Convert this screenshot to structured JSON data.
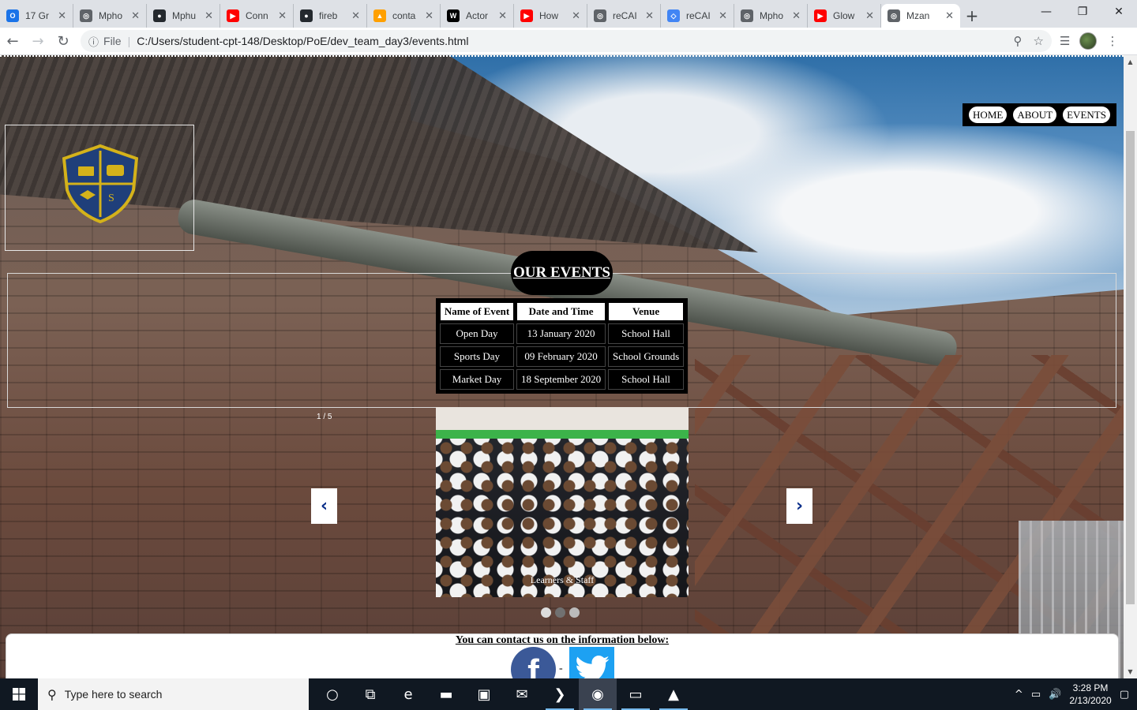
{
  "browser": {
    "tabs": [
      {
        "title": "17 Gr",
        "fav_color": "#1a73e8",
        "fav_glyph": "O"
      },
      {
        "title": "Mpho",
        "fav_color": "#5f6368",
        "fav_glyph": "◎"
      },
      {
        "title": "Mphu",
        "fav_color": "#24292e",
        "fav_glyph": "●"
      },
      {
        "title": "Conn",
        "fav_color": "#ff0000",
        "fav_glyph": "▶"
      },
      {
        "title": "fireb",
        "fav_color": "#24292e",
        "fav_glyph": "●"
      },
      {
        "title": "conta",
        "fav_color": "#ffa000",
        "fav_glyph": "▲"
      },
      {
        "title": "Actor",
        "fav_color": "#000000",
        "fav_glyph": "W"
      },
      {
        "title": "How",
        "fav_color": "#ff0000",
        "fav_glyph": "▶"
      },
      {
        "title": "reCAI",
        "fav_color": "#5f6368",
        "fav_glyph": "◎"
      },
      {
        "title": "reCAI",
        "fav_color": "#4285f4",
        "fav_glyph": "◇"
      },
      {
        "title": "Mpho",
        "fav_color": "#5f6368",
        "fav_glyph": "◎"
      },
      {
        "title": "Glow",
        "fav_color": "#ff0000",
        "fav_glyph": "▶"
      },
      {
        "title": "Mzan",
        "fav_color": "#5f6368",
        "fav_glyph": "◎",
        "active": true
      }
    ],
    "new_tab_label": "+",
    "window_controls": {
      "minimize": "—",
      "maximize": "❐",
      "close": "✕"
    },
    "address": {
      "info_icon": "ⓘ",
      "scheme_label": "File",
      "separator": "|",
      "url": "C:/Users/student-cpt-148/Desktop/PoE/dev_team_day3/events.html"
    },
    "nav": {
      "back": "←",
      "forward": "→",
      "reload": "↻"
    },
    "toolbar_icons": {
      "zoom": "⚲",
      "star": "☆",
      "media": "☰",
      "menu": "⋮"
    }
  },
  "site": {
    "nav_links": [
      "HOME",
      "ABOUT",
      "EVENTS"
    ],
    "events_title": "OUR EVENTS",
    "events_table": {
      "headers": [
        "Name of Event",
        "Date and Time",
        "Venue"
      ],
      "rows": [
        [
          "Open Day",
          "13 January 2020",
          "School Hall"
        ],
        [
          "Sports Day",
          "09 February 2020",
          "School Grounds"
        ],
        [
          "Market Day",
          "18 September 2020",
          "School Hall"
        ]
      ]
    },
    "slideshow": {
      "counter": "1 / 5",
      "caption": "Learners & Staff",
      "prev_label": "‹",
      "next_label": "›",
      "dots_count": 3,
      "active_dot": 1
    },
    "contact": {
      "text": "You can contact us on the information below:",
      "facebook_glyph": "f",
      "separator": "-"
    },
    "crest_color": "#1f3f7a",
    "crest_border": "#d4b21a"
  },
  "taskbar": {
    "search_placeholder": "Type here to search",
    "search_icon": "⚲",
    "icons": [
      {
        "name": "cortana-icon",
        "glyph": "○"
      },
      {
        "name": "task-view-icon",
        "glyph": "⧉"
      },
      {
        "name": "edge-icon",
        "glyph": "e"
      },
      {
        "name": "file-explorer-icon",
        "glyph": "▬"
      },
      {
        "name": "store-icon",
        "glyph": "▣"
      },
      {
        "name": "mail-icon",
        "glyph": "✉"
      },
      {
        "name": "vscode-icon",
        "glyph": "❯"
      },
      {
        "name": "chrome-icon",
        "glyph": "◉"
      },
      {
        "name": "terminal-icon",
        "glyph": "▭"
      },
      {
        "name": "photos-icon",
        "glyph": "▲"
      }
    ],
    "tray": {
      "chevron": "^",
      "network": "▭",
      "volume": "🔊",
      "notifications": "▢"
    },
    "time": "3:28 PM",
    "date": "2/13/2020"
  }
}
